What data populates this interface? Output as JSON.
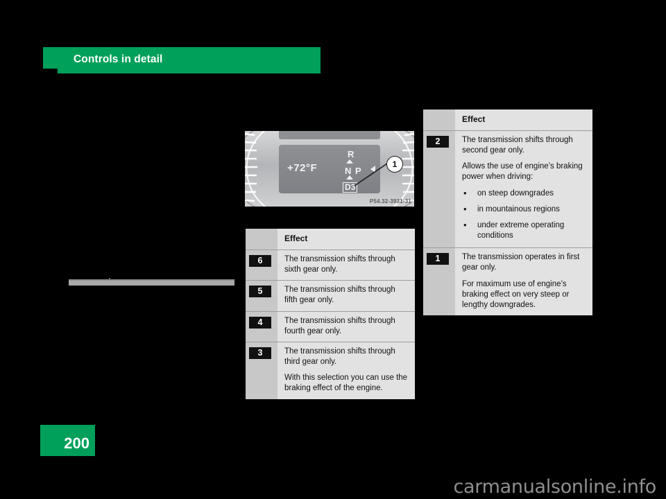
{
  "header": {
    "title": "Controls in detail",
    "accent_color": "#00a05a"
  },
  "page": {
    "number": "200",
    "badge_color": "#00a05a"
  },
  "figure": {
    "caption_code": "P54.32-3931-31",
    "callout_number": "1",
    "display": {
      "temperature": "+72°F",
      "gear_positions": [
        "R",
        "N",
        "P"
      ],
      "selected_gear": "D3"
    }
  },
  "table_left": {
    "header": {
      "blank": "",
      "effect": "Effect"
    },
    "rows": [
      {
        "gear": "6",
        "paragraphs": [
          "The transmission shifts through sixth gear only."
        ]
      },
      {
        "gear": "5",
        "paragraphs": [
          "The transmission shifts through fifth gear only."
        ]
      },
      {
        "gear": "4",
        "paragraphs": [
          "The transmission shifts through fourth gear only."
        ]
      },
      {
        "gear": "3",
        "paragraphs": [
          "The transmission shifts through third gear only.",
          "With this selection you can use the braking effect of the engine."
        ]
      }
    ]
  },
  "table_right": {
    "header": {
      "blank": "",
      "effect": "Effect"
    },
    "rows": [
      {
        "gear": "2",
        "paragraphs": [
          "The transmission shifts through second gear only.",
          "Allows the use of engine’s braking power when driving:"
        ],
        "bullets": [
          "on steep downgrades",
          "in mountainous regions",
          "under extreme operating conditions"
        ]
      },
      {
        "gear": "1",
        "paragraphs": [
          "The transmission operates in first gear only.",
          "For maximum use of engine’s braking effect on very steep or lengthy downgrades."
        ],
        "bullets": []
      }
    ]
  },
  "watermark": {
    "text": "carmanualsonline.info"
  }
}
